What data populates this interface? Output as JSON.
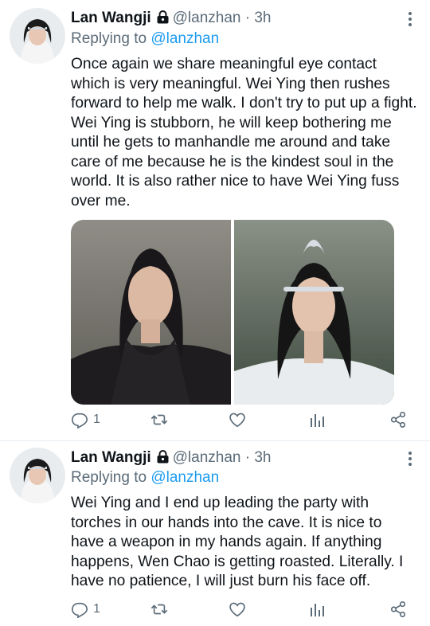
{
  "tweets": [
    {
      "author": "Lan Wangji",
      "handle": "@lanzhan",
      "time": "3h",
      "separator": "·",
      "reply_prefix": "Replying to",
      "reply_to": "@lanzhan",
      "text": "Once again we share meaningful eye contact which is very meaningful. Wei Ying then rushes forward to help me walk. I don't try to put up a fight. Wei Ying is stubborn, he will keep bothering me until he gets to manhandle me around and take care of me because he is the kindest soul in the world. It is also rather nice to have Wei Ying fuss over me.",
      "reply_count": "1",
      "media": [
        "portrait-wei-ying",
        "portrait-lan-wangji"
      ]
    },
    {
      "author": "Lan Wangji",
      "handle": "@lanzhan",
      "time": "3h",
      "separator": "·",
      "reply_prefix": "Replying to",
      "reply_to": "@lanzhan",
      "text": "Wei Ying and I end up leading the party with torches in our hands into the cave. It is nice to have a weapon in my hands again. If anything happens, Wen Chao is getting roasted. Literally. I have no patience, I will just burn his face off.",
      "reply_count": "1"
    }
  ],
  "icons": {
    "lock": "lock-icon",
    "more": "more-vertical-icon",
    "reply": "reply-icon",
    "retweet": "retweet-icon",
    "like": "heart-icon",
    "analytics": "analytics-icon",
    "share": "share-icon"
  },
  "colors": {
    "link": "#1d9bf0",
    "muted": "#5b6b78",
    "text": "#0f1419"
  }
}
